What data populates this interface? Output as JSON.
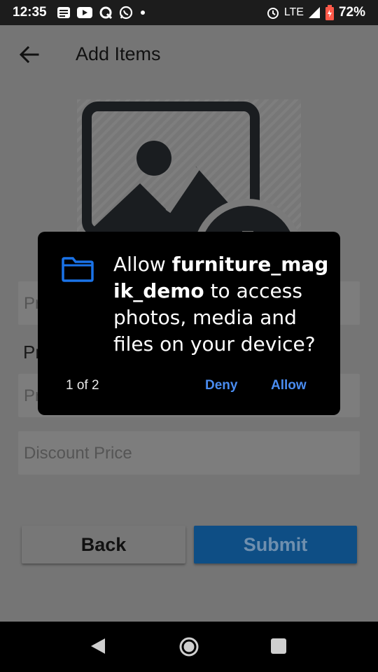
{
  "status_bar": {
    "time": "12:35",
    "network": "LTE",
    "battery": "72%"
  },
  "app_bar": {
    "title": "Add Items"
  },
  "form": {
    "name_placeholder": "Pr",
    "product_label": "Pr",
    "price_placeholder": "Price",
    "discount_placeholder": "Discount Price"
  },
  "buttons": {
    "back_label": "Back",
    "submit_label": "Submit"
  },
  "dialog": {
    "message_prefix": "Allow ",
    "app_name": "furniture_magik_demo",
    "message_suffix": " to access photos, media and files on your device?",
    "counter": "1 of 2",
    "deny_label": "Deny",
    "allow_label": "Allow"
  },
  "colors": {
    "accent": "#4a8cf0",
    "submit_bg": "#0e4e85"
  }
}
